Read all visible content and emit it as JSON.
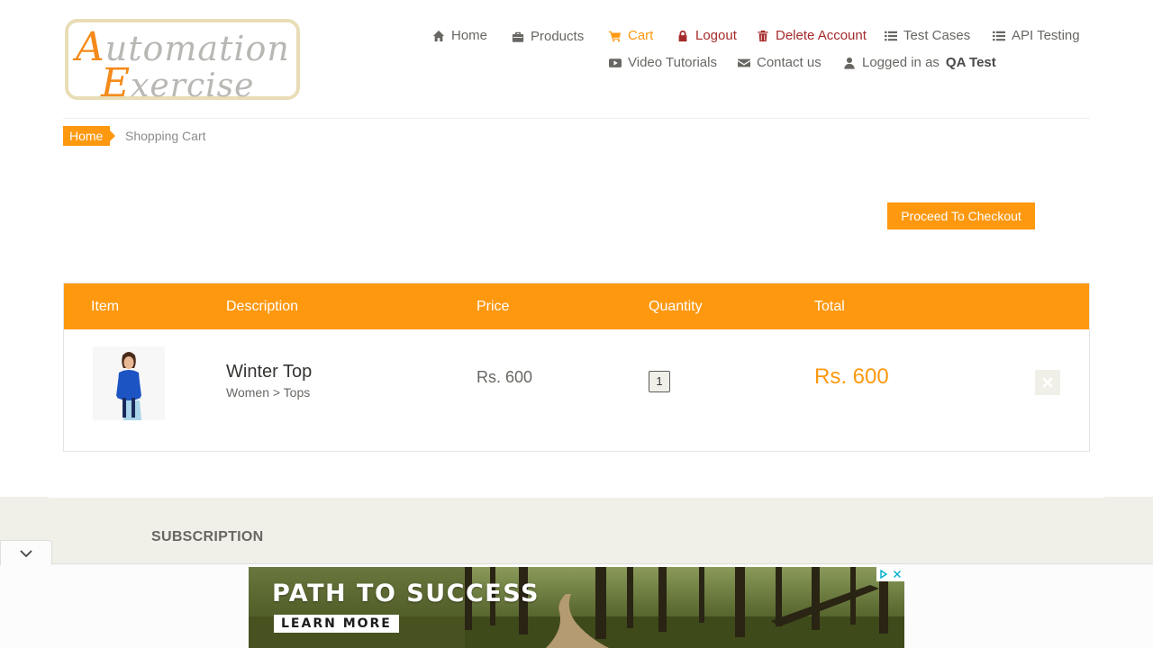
{
  "logo": {
    "line1_first": "A",
    "line1_rest": "utomation",
    "line2_first": "E",
    "line2_rest": "xercise"
  },
  "nav": {
    "home": "Home",
    "products": "Products",
    "cart": "Cart",
    "logout": "Logout",
    "delete_account": "Delete Account",
    "test_cases": "Test Cases",
    "api_testing": "API Testing",
    "video_tutorials": "Video Tutorials",
    "contact_us": "Contact us",
    "logged_in_prefix": "Logged in as",
    "username": "QA Test"
  },
  "breadcrumb": {
    "home": "Home",
    "current": "Shopping Cart"
  },
  "checkout_label": "Proceed To Checkout",
  "cart": {
    "headers": {
      "item": "Item",
      "description": "Description",
      "price": "Price",
      "quantity": "Quantity",
      "total": "Total"
    },
    "rows": [
      {
        "name": "Winter Top",
        "category": "Women > Tops",
        "price": "Rs. 600",
        "quantity": "1",
        "total": "Rs. 600"
      }
    ]
  },
  "footer": {
    "subscription": "SUBSCRIPTION"
  },
  "ad": {
    "title": "PATH TO SUCCESS",
    "cta": "LEARN MORE"
  },
  "icons": {
    "home": "home-icon",
    "products": "briefcase-icon",
    "cart": "shopping-cart-icon",
    "logout": "lock-icon",
    "delete": "trash-icon",
    "test_cases": "list-icon",
    "api": "list-icon",
    "video": "youtube-play-icon",
    "contact": "envelope-icon",
    "user": "user-icon",
    "remove": "times-icon",
    "collapse": "chevron-down-icon",
    "adchoices": "adchoices-icon",
    "close": "close-icon"
  },
  "colors": {
    "accent": "#fe980f",
    "danger": "#a52a2a",
    "text": "#696763",
    "footer_bg": "#f0f0e9"
  }
}
